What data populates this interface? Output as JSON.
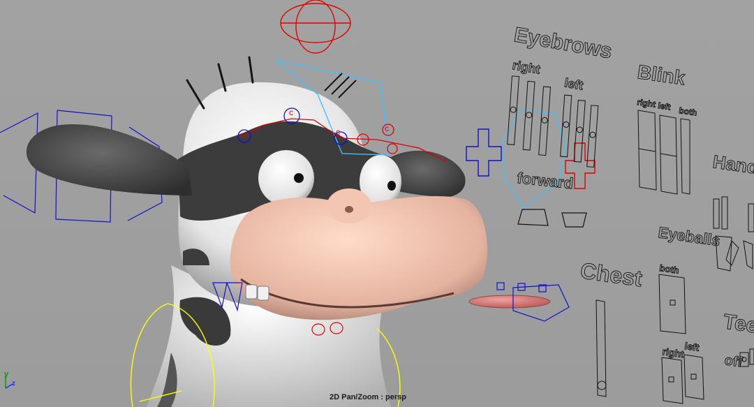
{
  "viewport": {
    "hud_label": "2D Pan/Zoom : persp",
    "axis": {
      "y": "y",
      "z": "z"
    }
  },
  "controls": {
    "eyebrows": {
      "title": "Eyebrows",
      "right": "right",
      "left": "left",
      "forward": "forward"
    },
    "blink": {
      "title": "Blink",
      "right": "right",
      "left": "left",
      "both": "both"
    },
    "hands": {
      "title": "Hands"
    },
    "eyeballs": {
      "title": "Eyeballs",
      "both": "both",
      "right": "right",
      "left": "left"
    },
    "chest": {
      "title": "Chest"
    },
    "teeth": {
      "title": "Teeth",
      "off": "off"
    }
  },
  "colors": {
    "viewport_bg": "#a0a0a0",
    "rig_red": "#e00000",
    "rig_blue": "#1010d0",
    "rig_cyan": "#40c0ff",
    "rig_yellow": "#ffff00",
    "control_outline": "#111111"
  }
}
